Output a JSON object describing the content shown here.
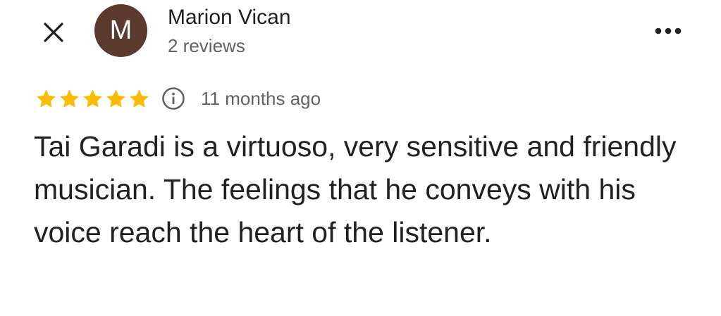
{
  "header": {
    "close_icon": "close-icon",
    "avatar_letter": "M",
    "avatar_color": "#5b3a2e",
    "reviewer_name": "Marion Vican",
    "review_count": "2 reviews",
    "more_icon": "more-horizontal-icon"
  },
  "review": {
    "rating": 5,
    "rating_max": 5,
    "star_color": "#fbbc04",
    "info_icon": "info-icon",
    "time_ago": "11 months ago",
    "text": "Tai Garadi is a virtuoso, very sensitive and friendly musician. The feelings that he conveys with his voice reach the heart of the listener."
  }
}
